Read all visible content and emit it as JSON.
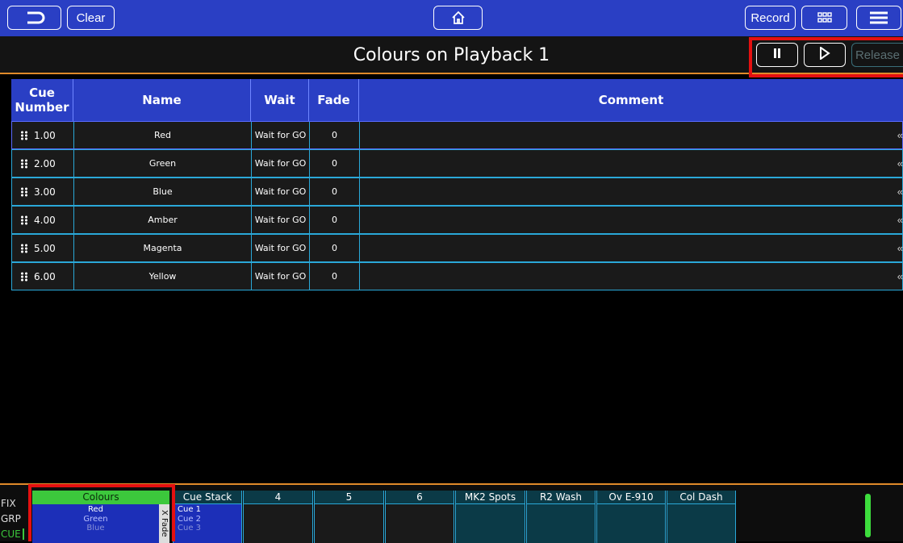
{
  "toolbar": {
    "back_icon": "back-arrow-icon",
    "clear_label": "Clear",
    "home_icon": "home-icon",
    "record_label": "Record",
    "grid_icon": "grid-icon",
    "menu_icon": "menu-icon"
  },
  "title_bar": {
    "title": "Colours on Playback 1",
    "pause_icon": "pause-icon",
    "play_icon": "play-icon",
    "release_label": "Release"
  },
  "table": {
    "headers": [
      "Cue Number",
      "Name",
      "Wait",
      "Fade",
      "Comment"
    ],
    "rows": [
      {
        "number": "1.00",
        "name": "Red",
        "wait": "Wait for GO",
        "fade": "0",
        "comment": ""
      },
      {
        "number": "2.00",
        "name": "Green",
        "wait": "Wait for GO",
        "fade": "0",
        "comment": ""
      },
      {
        "number": "3.00",
        "name": "Blue",
        "wait": "Wait for GO",
        "fade": "0",
        "comment": ""
      },
      {
        "number": "4.00",
        "name": "Amber",
        "wait": "Wait for GO",
        "fade": "0",
        "comment": ""
      },
      {
        "number": "5.00",
        "name": "Magenta",
        "wait": "Wait for GO",
        "fade": "0",
        "comment": ""
      },
      {
        "number": "6.00",
        "name": "Yellow",
        "wait": "Wait for GO",
        "fade": "0",
        "comment": ""
      }
    ],
    "row_chevron": "«"
  },
  "bottom": {
    "side_labels": [
      "FIX",
      "GRP",
      "CUE"
    ],
    "colours": {
      "title": "Colours",
      "cues": [
        "Red",
        "Green",
        "Blue"
      ],
      "xfade": "X Fade"
    },
    "cue_stack": {
      "title": "Cue Stack",
      "cues": [
        "Cue 1",
        "Cue 2",
        "Cue 3"
      ]
    },
    "playbacks": [
      "4",
      "5",
      "6",
      "MK2 Spots",
      "R2 Wash",
      "Ov E-910",
      "Col Dash"
    ]
  },
  "colors": {
    "toolbar_blue": "#2a3fc4",
    "accent_orange": "#e08a2a",
    "highlight_red": "#e41010",
    "active_green": "#3cc83c",
    "border_cyan": "#2aa8d8"
  }
}
